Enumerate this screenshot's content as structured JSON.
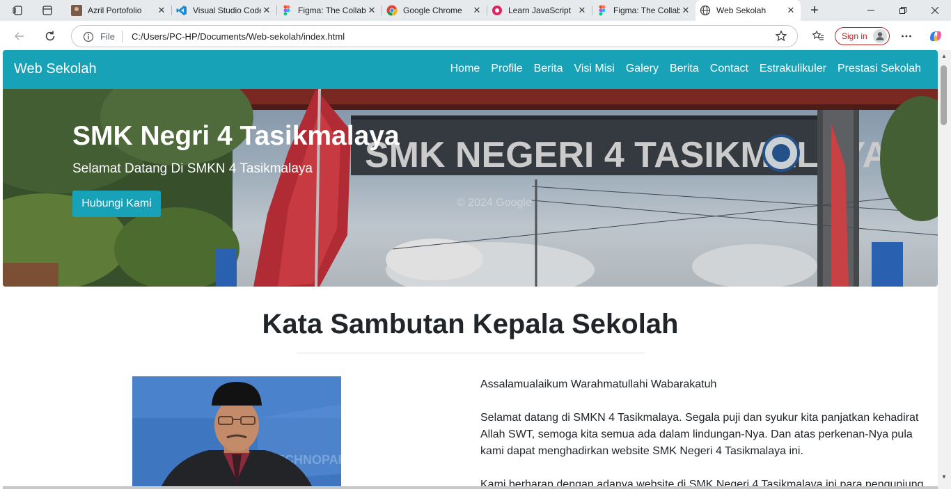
{
  "browser": {
    "tabs": [
      {
        "title": "Azril Portofolio",
        "icon": "portfolio-favicon"
      },
      {
        "title": "Visual Studio Code",
        "icon": "vscode-favicon"
      },
      {
        "title": "Figma: The Collaborative",
        "icon": "figma-favicon"
      },
      {
        "title": "Google Chrome",
        "icon": "chrome-favicon"
      },
      {
        "title": "Learn JavaScript",
        "icon": "scrimba-favicon"
      },
      {
        "title": "Figma: The Collaborative",
        "icon": "figma-favicon"
      },
      {
        "title": "Web Sekolah",
        "icon": "globe-favicon",
        "active": true
      }
    ],
    "address": {
      "scheme": "File",
      "url": "C:/Users/PC-HP/Documents/Web-sekolah/index.html"
    },
    "signin_label": "Sign in"
  },
  "site": {
    "brand": "Web Sekolah",
    "nav": [
      "Home",
      "Profile",
      "Berita",
      "Visi Misi",
      "Galery",
      "Berita",
      "Contact",
      "Estrakulikuler",
      "Prestasi Sekolah"
    ],
    "hero": {
      "title": "SMK Negri 4 Tasikmalaya",
      "subtitle": "Selamat Datang Di SMKN 4 Tasikmalaya",
      "button": "Hubungi Kami",
      "gate_sign": "SMK NEGERI 4 TASIKMALAYA",
      "watermark": "© 2024 Google"
    },
    "section": {
      "title": "Kata Sambutan Kepala Sekolah",
      "paragraphs": [
        "Assalamualaikum Warahmatullahi Wabarakatuh",
        "Selamat datang di SMKN 4 Tasikmalaya. Segala puji dan syukur kita panjatkan kehadirat Allah SWT, semoga kita semua ada dalam lindungan-Nya. Dan atas perkenan-Nya pula kami dapat menghadirkan website SMK Negeri 4 Tasikmalaya ini.",
        "Kami berharap dengan adanya website di SMK Negeri 4 Tasikmalaya ini para pengunjung"
      ],
      "photo_backdrop_text": "TECHNOPARK"
    }
  },
  "colors": {
    "primary": "#17a2b8",
    "text": "#212529"
  }
}
